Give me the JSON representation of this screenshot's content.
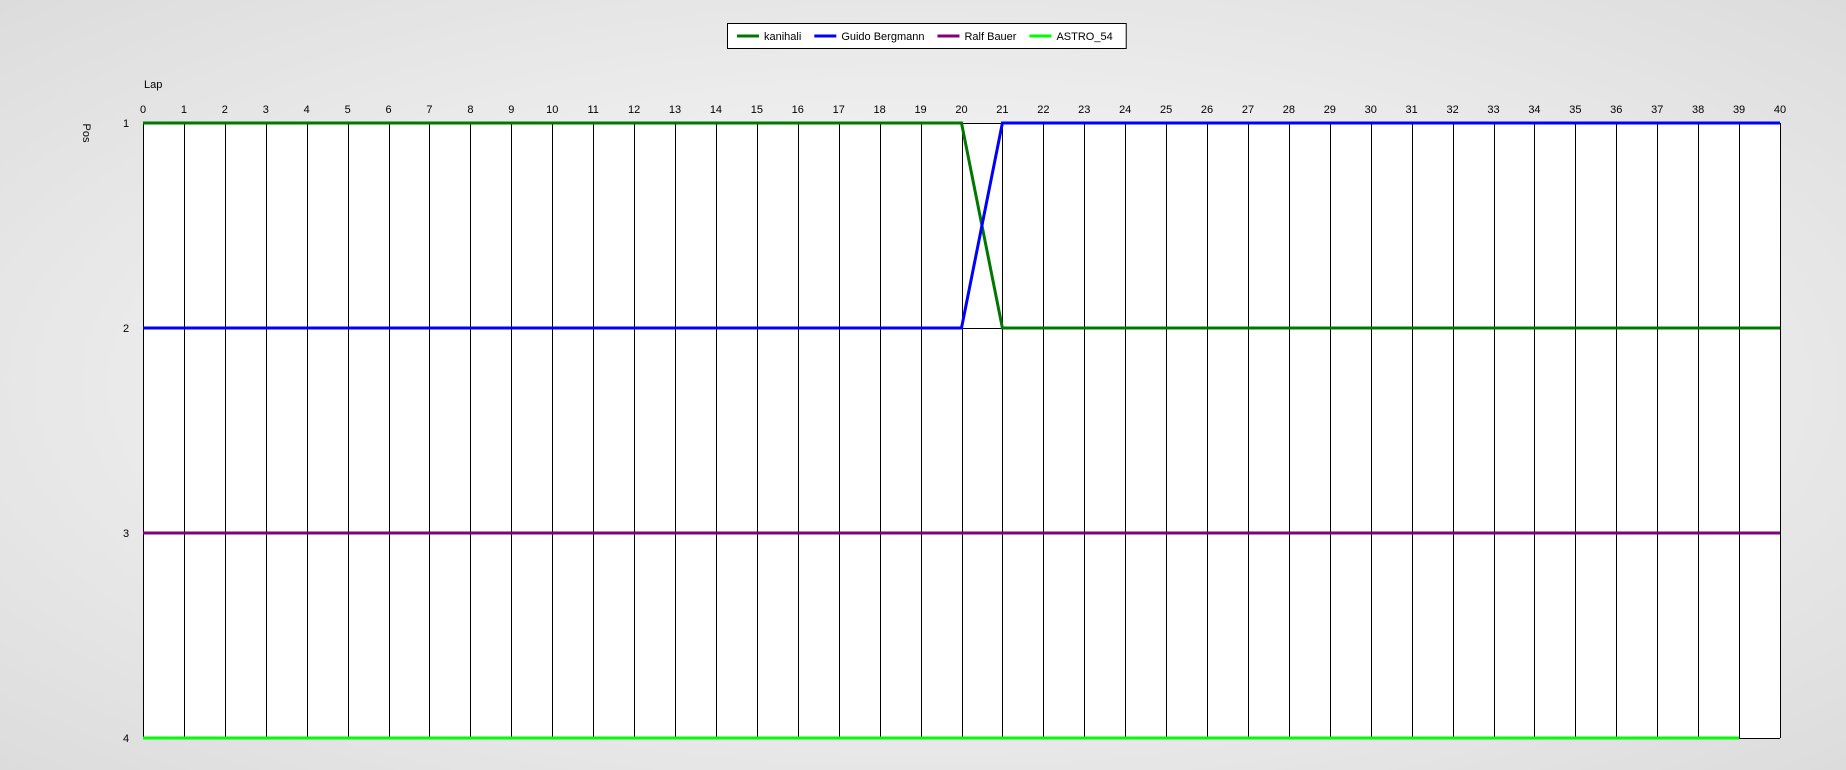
{
  "chart_data": {
    "type": "line",
    "xlabel": "Lap",
    "ylabel": "Pos",
    "xlim": [
      0,
      40
    ],
    "ylim": [
      1,
      4
    ],
    "y_inverted": true,
    "x_ticks": [
      0,
      1,
      2,
      3,
      4,
      5,
      6,
      7,
      8,
      9,
      10,
      11,
      12,
      13,
      14,
      15,
      16,
      17,
      18,
      19,
      20,
      21,
      22,
      23,
      24,
      25,
      26,
      27,
      28,
      29,
      30,
      31,
      32,
      33,
      34,
      35,
      36,
      37,
      38,
      39,
      40
    ],
    "y_ticks": [
      1,
      2,
      3,
      4
    ],
    "grid": "vertical",
    "legend_placement": "top-center",
    "series": [
      {
        "name": "kanihali",
        "color": "#007800",
        "x": [
          0,
          20,
          21,
          40
        ],
        "y": [
          1,
          1,
          2,
          2
        ]
      },
      {
        "name": "Guido Bergmann",
        "color": "#0000ff",
        "x": [
          0,
          20,
          21,
          40
        ],
        "y": [
          2,
          2,
          1,
          1
        ]
      },
      {
        "name": "Ralf Bauer",
        "color": "#800080",
        "x": [
          0,
          40
        ],
        "y": [
          3,
          3
        ]
      },
      {
        "name": "ASTRO_54",
        "color": "#00ff00",
        "x": [
          0,
          39
        ],
        "y": [
          4,
          4
        ]
      }
    ]
  }
}
